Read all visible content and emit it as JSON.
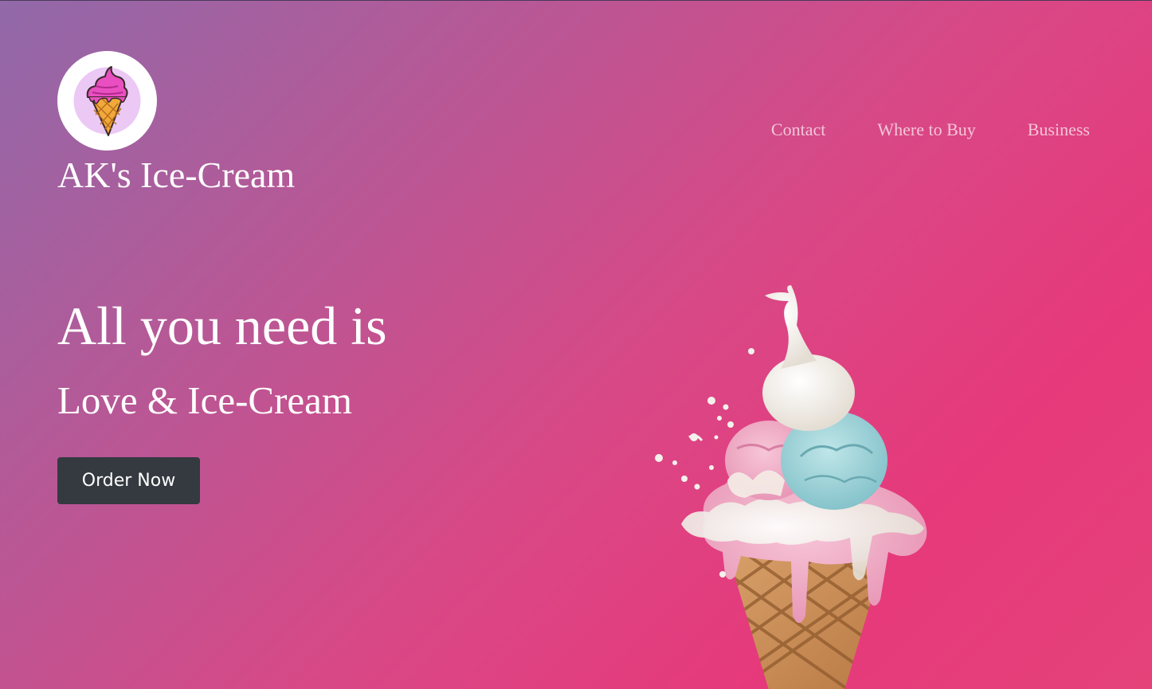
{
  "brand": {
    "name": "AK's Ice-Cream",
    "logo_icon": "ice-cream-cone-icon"
  },
  "nav": {
    "items": [
      {
        "label": "Contact"
      },
      {
        "label": "Where to Buy"
      },
      {
        "label": "Business"
      }
    ]
  },
  "hero": {
    "title": "All you need is",
    "subtitle": "Love & Ice-Cream",
    "cta_label": "Order Now",
    "image_icon": "ice-cream-cone-illustration"
  },
  "colors": {
    "gradient_start": "#9169a9",
    "gradient_end": "#e6397b",
    "nav_link": "#f3c6d8",
    "button_bg": "#343a40",
    "text": "#ffffff"
  }
}
